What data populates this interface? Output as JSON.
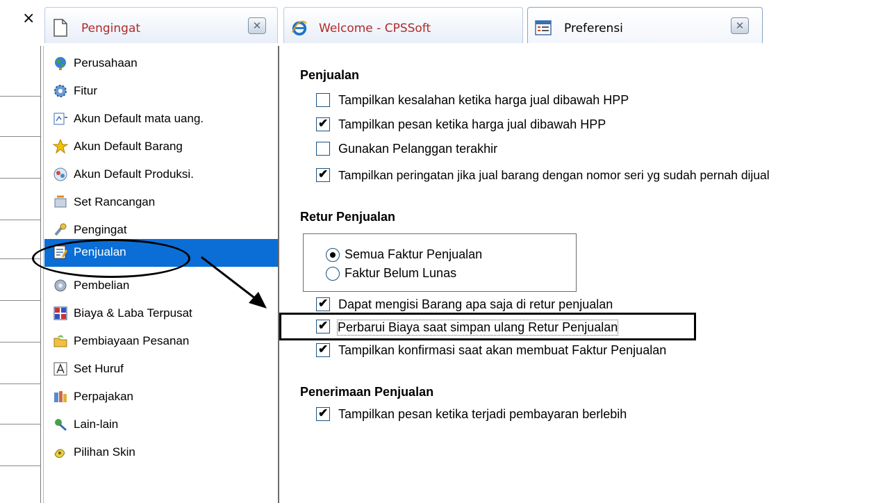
{
  "tabs": [
    {
      "label": "Pengingat",
      "icon": "page-icon",
      "close": "close-tab-icon"
    },
    {
      "label": "Welcome - CPSSoft",
      "icon": "ie-icon"
    },
    {
      "label": "Preferensi",
      "icon": "form-icon",
      "close": "close-tab-icon"
    }
  ],
  "tree": {
    "items": [
      {
        "label": "Perusahaan",
        "icon": "globe-icon"
      },
      {
        "label": "Fitur",
        "icon": "gear-icon"
      },
      {
        "label": "Akun Default mata uang.",
        "icon": "currency-icon"
      },
      {
        "label": "Akun Default Barang",
        "icon": "star-icon"
      },
      {
        "label": "Akun Default Produksi.",
        "icon": "production-icon"
      },
      {
        "label": "Set Rancangan",
        "icon": "design-icon"
      },
      {
        "label": "Pengingat",
        "icon": "reminder-icon"
      },
      {
        "label": "Penjualan",
        "icon": "sales-icon",
        "selected": true
      },
      {
        "label": "Pembelian",
        "icon": "purchase-icon"
      },
      {
        "label": "Biaya & Laba Terpusat",
        "icon": "grid-icon"
      },
      {
        "label": "Pembiayaan Pesanan",
        "icon": "folder-icon"
      },
      {
        "label": "Set Huruf",
        "icon": "font-icon"
      },
      {
        "label": "Perpajakan",
        "icon": "tax-icon"
      },
      {
        "label": "Lain-lain",
        "icon": "misc-icon"
      },
      {
        "label": "Pilihan Skin",
        "icon": "skin-icon"
      }
    ]
  },
  "sections": {
    "penjualan": {
      "title": "Penjualan",
      "options": [
        {
          "label": "Tampilkan kesalahan ketika harga jual dibawah HPP",
          "checked": false
        },
        {
          "label": "Tampilkan pesan ketika harga jual dibawah HPP",
          "checked": true
        },
        {
          "label": "Gunakan Pelanggan terakhir",
          "checked": false
        },
        {
          "label": "Tampilkan peringatan jika jual barang dengan nomor seri yg sudah pernah dijual",
          "checked": true
        }
      ]
    },
    "retur": {
      "title": "Retur Penjualan",
      "radios": [
        {
          "label": "Semua Faktur Penjualan",
          "selected": true
        },
        {
          "label": "Faktur Belum Lunas",
          "selected": false
        }
      ],
      "options": [
        {
          "label": "Dapat mengisi Barang apa saja di retur penjualan",
          "checked": true
        },
        {
          "label": "Perbarui Biaya saat simpan ulang Retur Penjualan",
          "checked": true
        },
        {
          "label": "Tampilkan konfirmasi saat akan membuat Faktur Penjualan",
          "checked": true
        }
      ]
    },
    "penerimaan": {
      "title": "Penerimaan Penjualan",
      "options": [
        {
          "label": "Tampilkan pesan ketika terjadi pembayaran berlebih",
          "checked": true
        }
      ]
    }
  },
  "check_mark": "✔",
  "close_glyph": "×",
  "tab_close_glyph": "⊠"
}
